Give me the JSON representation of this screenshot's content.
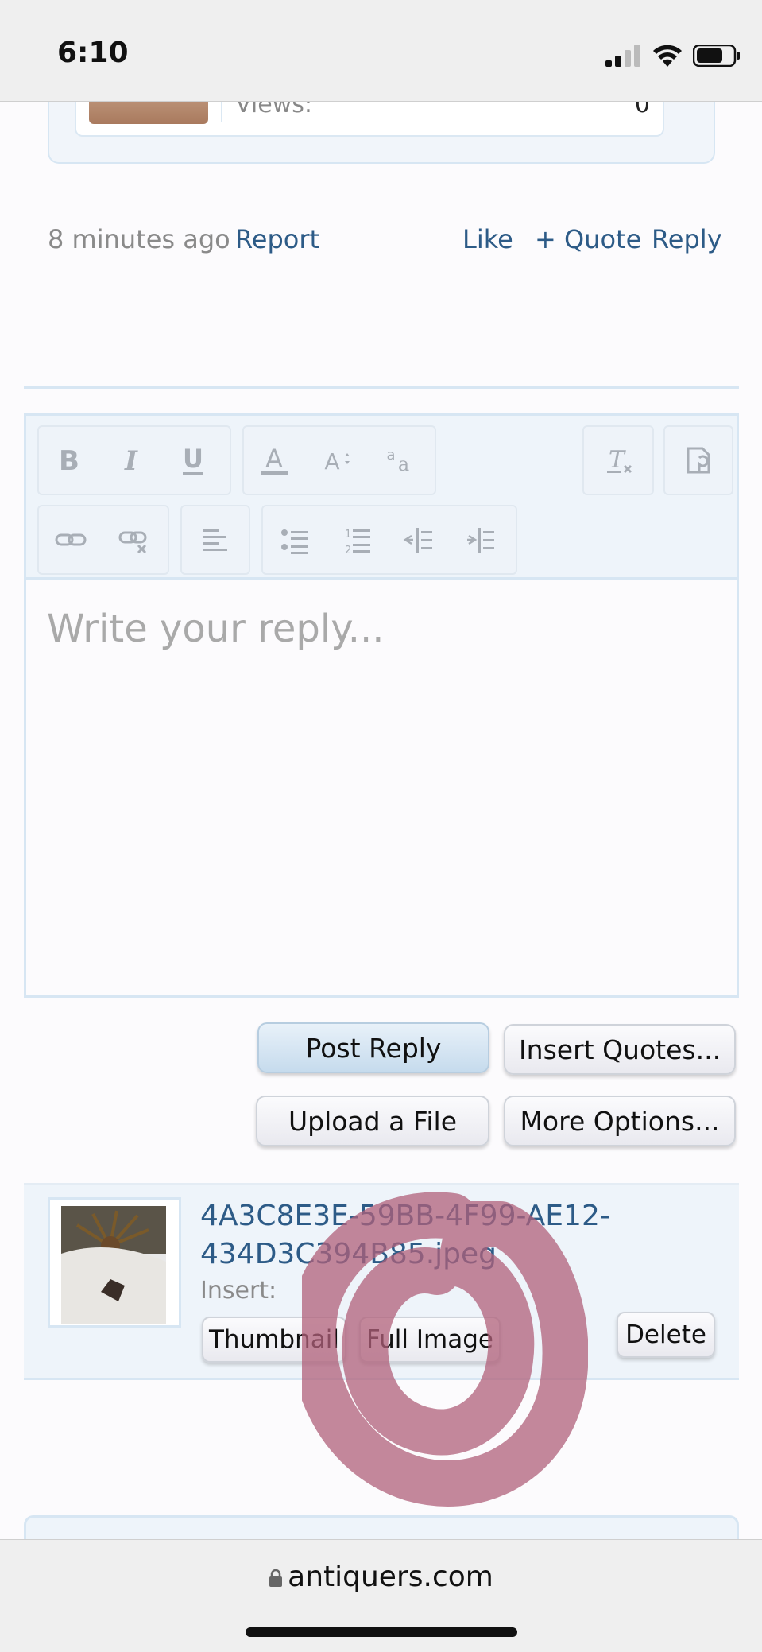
{
  "status_bar": {
    "time": "6:10"
  },
  "post": {
    "views_label": "Views:",
    "views_value": "0",
    "time_ago": "8 minutes ago",
    "report": "Report",
    "like": "Like",
    "quote": "+ Quote",
    "reply": "Reply"
  },
  "editor": {
    "placeholder": "Write your reply...",
    "toolbar_icons": [
      "bold-icon",
      "italic-icon",
      "underline-icon",
      "font-color-icon",
      "font-size-icon",
      "font-family-icon",
      "remove-format-icon",
      "editor-settings-icon",
      "link-icon",
      "unlink-icon",
      "align-icon",
      "bullet-list-icon",
      "numbered-list-icon",
      "outdent-icon",
      "indent-icon"
    ]
  },
  "actions": {
    "post_reply": "Post Reply",
    "insert_quotes": "Insert Quotes...",
    "upload_file": "Upload a File",
    "more_options": "More Options..."
  },
  "attachment": {
    "name_line1": "4A3C8E3E-59BB-4F99-AE12-",
    "name_line2": "434D3C394B85.jpeg",
    "insert_label": "Insert:",
    "thumbnail": "Thumbnail",
    "full_image": "Full Image",
    "delete": "Delete"
  },
  "browser": {
    "url": "antiquers.com"
  },
  "colors": {
    "link": "#2d5b87",
    "border": "#d7e6f3",
    "scribble": "#b0607a"
  }
}
